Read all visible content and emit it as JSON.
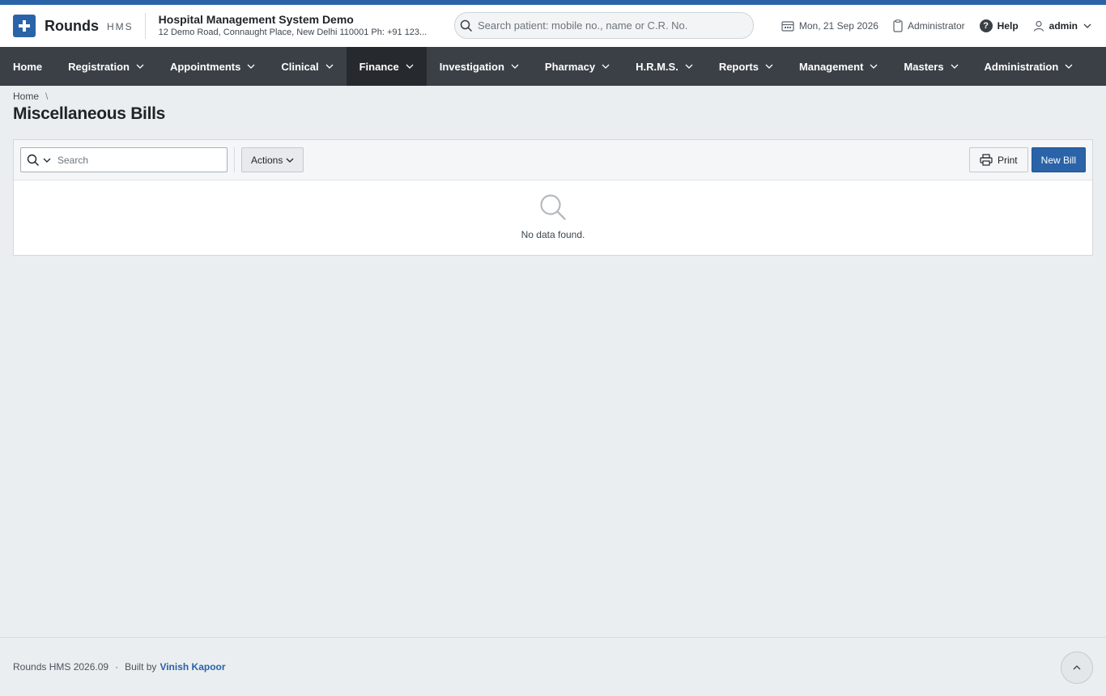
{
  "brand": {
    "name": "Rounds",
    "sub": "HMS",
    "accent": "#2a63a8"
  },
  "org": {
    "name": "Hospital Management System Demo",
    "address": "12 Demo Road, Connaught Place, New Delhi 110001 Ph: +91 123..."
  },
  "patient_search": {
    "placeholder": "Search patient: mobile no., name or C.R. No."
  },
  "header": {
    "date": "Mon, 21 Sep 2026",
    "role": "Administrator",
    "help": "Help",
    "user": "admin"
  },
  "nav": {
    "items": [
      {
        "label": "Home"
      },
      {
        "label": "Registration"
      },
      {
        "label": "Appointments"
      },
      {
        "label": "Clinical"
      },
      {
        "label": "Finance"
      },
      {
        "label": "Investigation"
      },
      {
        "label": "Pharmacy"
      },
      {
        "label": "H.R.M.S."
      },
      {
        "label": "Reports"
      },
      {
        "label": "Management"
      },
      {
        "label": "Masters"
      },
      {
        "label": "Administration"
      }
    ],
    "active": "Finance"
  },
  "breadcrumb": {
    "home": "Home",
    "separator": "\\"
  },
  "page": {
    "title": "Miscellaneous Bills"
  },
  "toolbar": {
    "search_placeholder": "Search",
    "actions_label": "Actions",
    "print_label": "Print",
    "new_label": "New Bill"
  },
  "empty": {
    "message": "No data found."
  },
  "footer": {
    "version": "Rounds HMS 2026.09",
    "built_by": "Built by",
    "author": "Vinish Kapoor"
  }
}
